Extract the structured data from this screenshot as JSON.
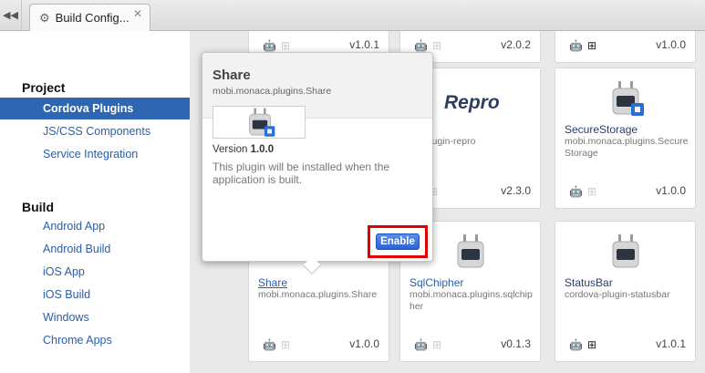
{
  "tabbar": {
    "nav_icon": "double-left-arrow-icon",
    "tab_label": "Build Config...",
    "tab_icon": "gear-icon",
    "close_glyph": "✕"
  },
  "sidebar": {
    "project_heading": "Project",
    "build_heading": "Build",
    "project_items": [
      {
        "label": "Cordova Plugins",
        "active": true
      },
      {
        "label": "JS/CSS Components",
        "active": false
      },
      {
        "label": "Service Integration",
        "active": false
      }
    ],
    "build_items": [
      {
        "label": "Android App"
      },
      {
        "label": "Android Build"
      },
      {
        "label": "iOS App"
      },
      {
        "label": "iOS Build"
      },
      {
        "label": "Windows"
      },
      {
        "label": "Chrome Apps"
      }
    ]
  },
  "cards": {
    "top_row_partial": [
      {
        "version": "v1.0.1"
      },
      {
        "version": "v2.0.2"
      },
      {
        "version": "v1.0.0"
      }
    ],
    "repro": {
      "logo_text": "Repro",
      "name_partial": "ro",
      "pkg_partial": "ova-plugin-repro",
      "version": "v2.3.0"
    },
    "securestorage": {
      "name": "SecureStorage",
      "pkg": "mobi.monaca.plugins.SecureStorage",
      "version": "v1.0.0"
    },
    "share": {
      "name": "Share",
      "pkg": "mobi.monaca.plugins.Share",
      "version": "v1.0.0"
    },
    "sqlchipher": {
      "name": "SqlChipher",
      "pkg": "mobi.monaca.plugins.sqlchipher",
      "version": "v0.1.3"
    },
    "statusbar": {
      "name": "StatusBar",
      "pkg": "cordova-plugin-statusbar",
      "version": "v1.0.1"
    }
  },
  "popover": {
    "title": "Share",
    "pkg": "mobi.monaca.plugins.Share",
    "version_label": "Version",
    "version_value": "1.0.0",
    "description": "This plugin will be installed when the application is built.",
    "enable_label": "Enable",
    "highlight_color": "#e00000"
  },
  "platform_icons": [
    "apple-icon",
    "android-icon",
    "windows-icon"
  ]
}
